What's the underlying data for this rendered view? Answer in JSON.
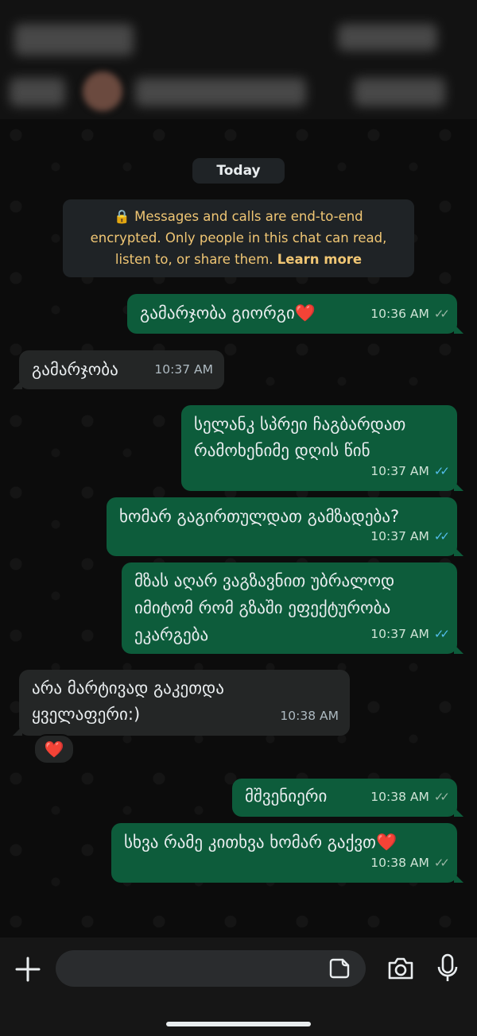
{
  "chat": {
    "day_label": "Today",
    "encryption_notice": {
      "line1": "Messages and calls are end-to-end",
      "line2": "encrypted. Only people in this chat can read,",
      "line3": "listen to, or share them.",
      "link": "Learn more"
    },
    "messages": [
      {
        "dir": "out",
        "text": "გამარჯობა გიორგი❤️",
        "time": "10:36 AM",
        "status": "sent"
      },
      {
        "dir": "in",
        "text": "გამარჯობა",
        "time": "10:37 AM"
      },
      {
        "dir": "out",
        "text_lines": [
          "სელანკ სპრეი ჩაგბარდათ",
          "რამოხენიმე დღის წინ"
        ],
        "time": "10:37 AM",
        "status": "read"
      },
      {
        "dir": "out",
        "text": "ხომარ გაგირთულდათ გამზადება?",
        "time": "10:37 AM",
        "status": "read"
      },
      {
        "dir": "out",
        "text_lines": [
          "მზას აღარ ვაგზავნით უბრალოდ",
          "იმიტომ რომ გზაში ეფექტურობა",
          "ეკარგება"
        ],
        "time": "10:37 AM",
        "status": "read"
      },
      {
        "dir": "in",
        "text_lines": [
          "არა მარტივად გაკეთდა",
          "ყველაფერი:)"
        ],
        "time": "10:38 AM",
        "reaction": "❤️"
      },
      {
        "dir": "out",
        "text": "მშვენიერი",
        "time": "10:38 AM",
        "status": "sent"
      },
      {
        "dir": "out",
        "text": "სხვა რამე კითხვა ხომარ გაქვთ❤️",
        "time": "10:38 AM",
        "status": "sent"
      }
    ]
  },
  "composer": {
    "attach_icon": "plus-icon",
    "sticker_icon": "sticker-icon",
    "camera_icon": "camera-icon",
    "mic_icon": "microphone-icon"
  },
  "colors": {
    "outgoing_bubble": "#0d5c3b",
    "incoming_bubble": "#242626",
    "read_ticks": "#53bdeb",
    "notice_text": "#f0c674"
  }
}
